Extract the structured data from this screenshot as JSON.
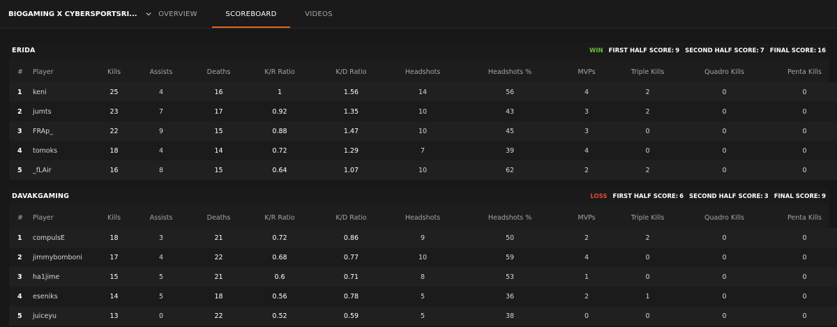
{
  "nav": {
    "match_title": "BIOGAMING X CYBERSPORTSRI...",
    "tabs": [
      {
        "label": "OVERVIEW",
        "active": false
      },
      {
        "label": "SCOREBOARD",
        "active": true
      },
      {
        "label": "VIDEOS",
        "active": false
      }
    ],
    "accent_color": "#e0691d"
  },
  "columns": [
    "#",
    "Player",
    "Kills",
    "Assists",
    "Deaths",
    "K/R Ratio",
    "K/D Ratio",
    "Headshots",
    "Headshots %",
    "MVPs",
    "Triple Kills",
    "Quadro Kills",
    "Penta Kills"
  ],
  "teams": [
    {
      "name": "ERIDA",
      "result": "WIN",
      "result_color": "#6cbf3b",
      "first_half_label": "FIRST HALF SCORE:",
      "first_half": "9",
      "second_half_label": "SECOND HALF SCORE:",
      "second_half": "7",
      "final_label": "FINAL SCORE:",
      "final": "16",
      "players": [
        [
          "1",
          "keni",
          "25",
          "4",
          "16",
          "1",
          "1.56",
          "14",
          "56",
          "4",
          "2",
          "0",
          "0"
        ],
        [
          "2",
          "jumts",
          "23",
          "7",
          "17",
          "0.92",
          "1.35",
          "10",
          "43",
          "3",
          "2",
          "0",
          "0"
        ],
        [
          "3",
          "FRAp_",
          "22",
          "9",
          "15",
          "0.88",
          "1.47",
          "10",
          "45",
          "3",
          "0",
          "0",
          "0"
        ],
        [
          "4",
          "tomoks",
          "18",
          "4",
          "14",
          "0.72",
          "1.29",
          "7",
          "39",
          "4",
          "0",
          "0",
          "0"
        ],
        [
          "5",
          "_fLAir",
          "16",
          "8",
          "15",
          "0.64",
          "1.07",
          "10",
          "62",
          "2",
          "2",
          "0",
          "0"
        ]
      ]
    },
    {
      "name": "DAVAKGAMING",
      "result": "LOSS",
      "result_color": "#e2483b",
      "first_half_label": "FIRST HALF SCORE:",
      "first_half": "6",
      "second_half_label": "SECOND HALF SCORE:",
      "second_half": "3",
      "final_label": "FINAL SCORE:",
      "final": "9",
      "players": [
        [
          "1",
          "compulsE",
          "18",
          "3",
          "21",
          "0.72",
          "0.86",
          "9",
          "50",
          "2",
          "2",
          "0",
          "0"
        ],
        [
          "2",
          "jimmybomboni",
          "17",
          "4",
          "22",
          "0.68",
          "0.77",
          "10",
          "59",
          "4",
          "0",
          "0",
          "0"
        ],
        [
          "3",
          "ha1jime",
          "15",
          "5",
          "21",
          "0.6",
          "0.71",
          "8",
          "53",
          "1",
          "0",
          "0",
          "0"
        ],
        [
          "4",
          "eseniks",
          "14",
          "5",
          "18",
          "0.56",
          "0.78",
          "5",
          "36",
          "2",
          "1",
          "0",
          "0"
        ],
        [
          "5",
          "juiceyu",
          "13",
          "0",
          "22",
          "0.52",
          "0.59",
          "5",
          "38",
          "0",
          "0",
          "0",
          "0"
        ]
      ]
    }
  ]
}
